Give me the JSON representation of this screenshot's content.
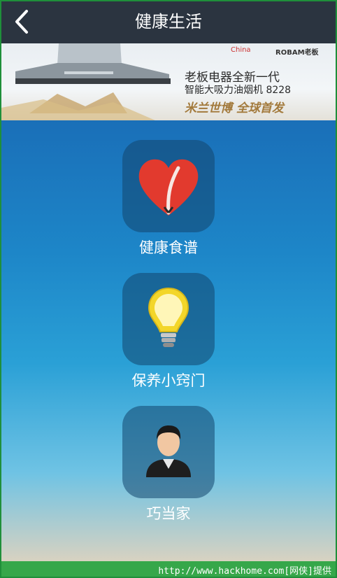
{
  "header": {
    "title": "健康生活",
    "back_icon": "chevron-left-icon"
  },
  "banner": {
    "brand_left": "China",
    "brand_right": "ROBAM老板",
    "line1": "老板电器全新一代",
    "line2": "智能大吸力油烟机 8228",
    "line3": "米兰世博  全球首发"
  },
  "menu": {
    "items": [
      {
        "label": "健康食谱",
        "icon": "heart-icon"
      },
      {
        "label": "保养小窍门",
        "icon": "lightbulb-icon"
      },
      {
        "label": "巧当家",
        "icon": "person-icon"
      }
    ]
  },
  "footer": {
    "watermark": "http://www.hackhome.com[网侠]提供"
  },
  "colors": {
    "header_bg": "#2b3440",
    "tile_bg": "#12466e",
    "footer_bg": "#36a74a"
  }
}
